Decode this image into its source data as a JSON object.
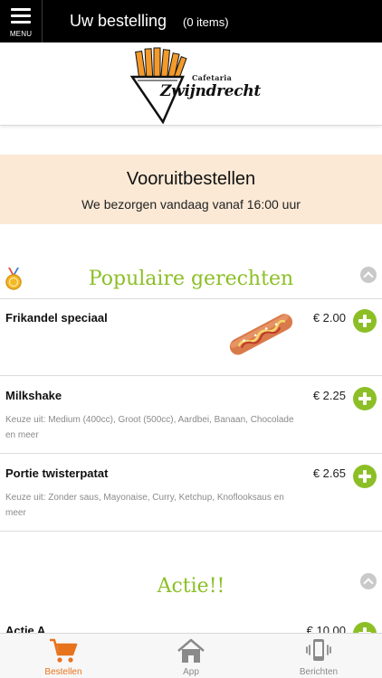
{
  "topbar": {
    "menu_label": "MENU",
    "title": "Uw bestelling",
    "count": "(0 items)"
  },
  "logo": {
    "small_text": "Cafetaria",
    "big_text": "Zwijndrecht"
  },
  "banner": {
    "title": "Vooruitbestellen",
    "subtitle": "We bezorgen vandaag vanaf 16:00 uur"
  },
  "sections": [
    {
      "title": "Populaire gerechten",
      "items": [
        {
          "name": "Frikandel speciaal",
          "price": "€ 2.00",
          "description": ""
        },
        {
          "name": "Milkshake",
          "price": "€ 2.25",
          "description": "Keuze uit: Medium (400cc), Groot (500cc), Aardbei, Banaan, Chocolade en meer"
        },
        {
          "name": "Portie twisterpatat",
          "price": "€ 2.65",
          "description": "Keuze uit: Zonder saus, Mayonaise, Curry, Ketchup, Knoflooksaus en meer"
        }
      ]
    },
    {
      "title": "Actie!!",
      "items": [
        {
          "name": "Actie A",
          "price": "€ 10.00",
          "description": ""
        }
      ]
    }
  ],
  "tabbar": {
    "tabs": [
      {
        "label": "Bestellen",
        "icon": "cart-icon",
        "active": true
      },
      {
        "label": "App",
        "icon": "home-icon",
        "active": false
      },
      {
        "label": "Berichten",
        "icon": "phone-vibrate-icon",
        "active": false
      }
    ]
  },
  "colors": {
    "accent_green": "#8cbf26",
    "accent_orange": "#e8731d",
    "banner_bg": "#fbe9d5",
    "topbar_bg": "#000000"
  }
}
